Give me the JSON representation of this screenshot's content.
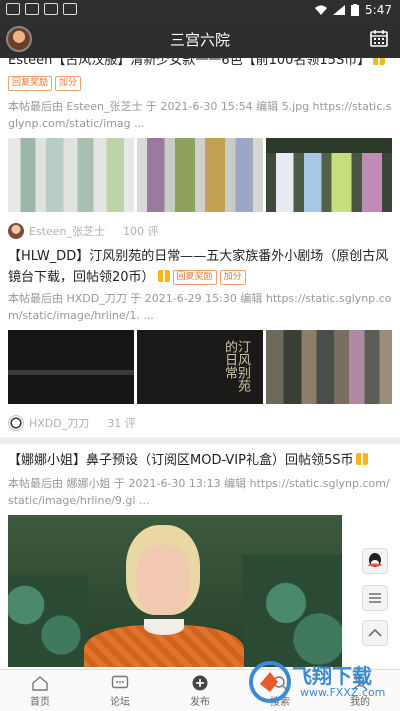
{
  "status_bar": {
    "time": "5:47"
  },
  "header": {
    "title": "三宫六院",
    "avatar_icon": "user-avatar",
    "calendar_icon": "calendar-icon"
  },
  "posts": [
    {
      "title": "Esteen【古风汉服】清新少女款一一6色【前100名领15S币】",
      "tags": [
        "回复奖励",
        "加分"
      ],
      "excerpt": "本帖最后由 Esteen_张芝士 于 2021-6-30 15:54 编辑 5.jpg https://static.sglynp.com/static/imag ...",
      "author": "Esteen_张芝士",
      "replies": "100 评"
    },
    {
      "title": "【HLW_DD】汀风别苑的日常——五大家族番外小剧场（原创古风镜台下载，回帖领20币）",
      "tags": [
        "回复奖励",
        "加分"
      ],
      "excerpt": "本帖最后由 HXDD_刀刀 于 2021-6-29 15:30 编辑 https://static.sglynp.com/static/image/hrline/1. ...",
      "thumb2_text": "汀风别苑的日常",
      "author": "HXDD_刀刀",
      "replies": "31 评"
    },
    {
      "title": "【娜娜小姐】鼻子预设（订阅区MOD-VIP礼盒）回帖领5S币",
      "excerpt": "本帖最后由 娜娜小姐 于 2021-6-30 13:13 编辑 https://static.sglynp.com/static/image/hrline/9.gi ..."
    }
  ],
  "bottom_tabs": [
    {
      "label": "首页",
      "icon": "home-icon"
    },
    {
      "label": "论坛",
      "icon": "chat-icon"
    },
    {
      "label": "发布",
      "icon": "plus-circle-icon"
    },
    {
      "label": "搜索",
      "icon": "search-icon"
    },
    {
      "label": "我的",
      "icon": "user-icon"
    }
  ],
  "watermark": {
    "text": "飞翔下载",
    "url": "www.FXXZ.com"
  },
  "colors": {
    "header_bg": "#2e2e2e",
    "tag": "#e8782c",
    "accent_blue": "#3a8ad6"
  }
}
